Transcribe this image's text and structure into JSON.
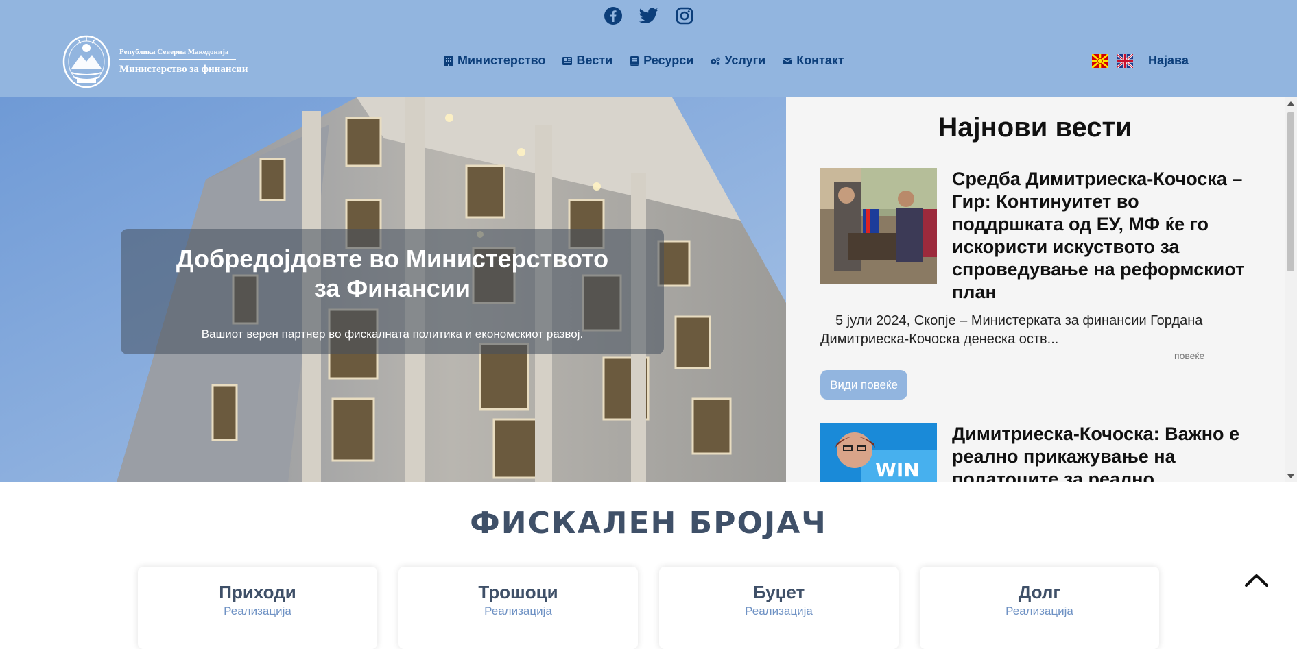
{
  "header": {
    "social": [
      {
        "icon": "facebook-icon"
      },
      {
        "icon": "twitter-icon"
      },
      {
        "icon": "instagram-icon"
      }
    ],
    "logo": {
      "line1": "Република Северна Македонија",
      "line2": "Министерство за финансии"
    },
    "nav": [
      {
        "label": "Министерство",
        "icon": "building-icon"
      },
      {
        "label": "Вести",
        "icon": "newspaper-icon"
      },
      {
        "label": "Ресурси",
        "icon": "book-icon"
      },
      {
        "label": "Услуги",
        "icon": "gears-icon"
      },
      {
        "label": "Контакт",
        "icon": "envelope-icon"
      }
    ],
    "login_label": "Најава"
  },
  "hero": {
    "title": "Добредојдовте во Министерството за Финансии",
    "subtitle": "Вашиот верен партнер во фискалната политика и економскиот развој."
  },
  "news": {
    "heading": "Најнови вести",
    "articles": [
      {
        "title": "Средба Димитриеска-Кочоска – Гир: Континуитет во поддршката од ЕУ, МФ ќе го искористи искуството за спроведување на реформскиот план",
        "excerpt": "5 јули 2024, Скопје – Министерката за финансии Гордана Димитриеска-Кочоска денеска оств...",
        "more_small": "повеќе",
        "button": "Види повеќе"
      },
      {
        "title": "Димитриеска-Кочоска: Важно е реално прикажување на податоците за реално"
      }
    ]
  },
  "fiscal": {
    "title": "ФИСКАЛЕН БРОЈАЧ",
    "cards": [
      {
        "title": "Приходи",
        "subtitle": "Реализација"
      },
      {
        "title": "Трошоци",
        "subtitle": "Реализација"
      },
      {
        "title": "Буџет",
        "subtitle": "Реализација"
      },
      {
        "title": "Долг",
        "subtitle": "Реализација"
      }
    ]
  },
  "colors": {
    "header_bg": "#92b5df",
    "nav_text": "#0c3e7a",
    "fiscal_title": "#3f5068",
    "card_sub": "#6f92c4"
  }
}
